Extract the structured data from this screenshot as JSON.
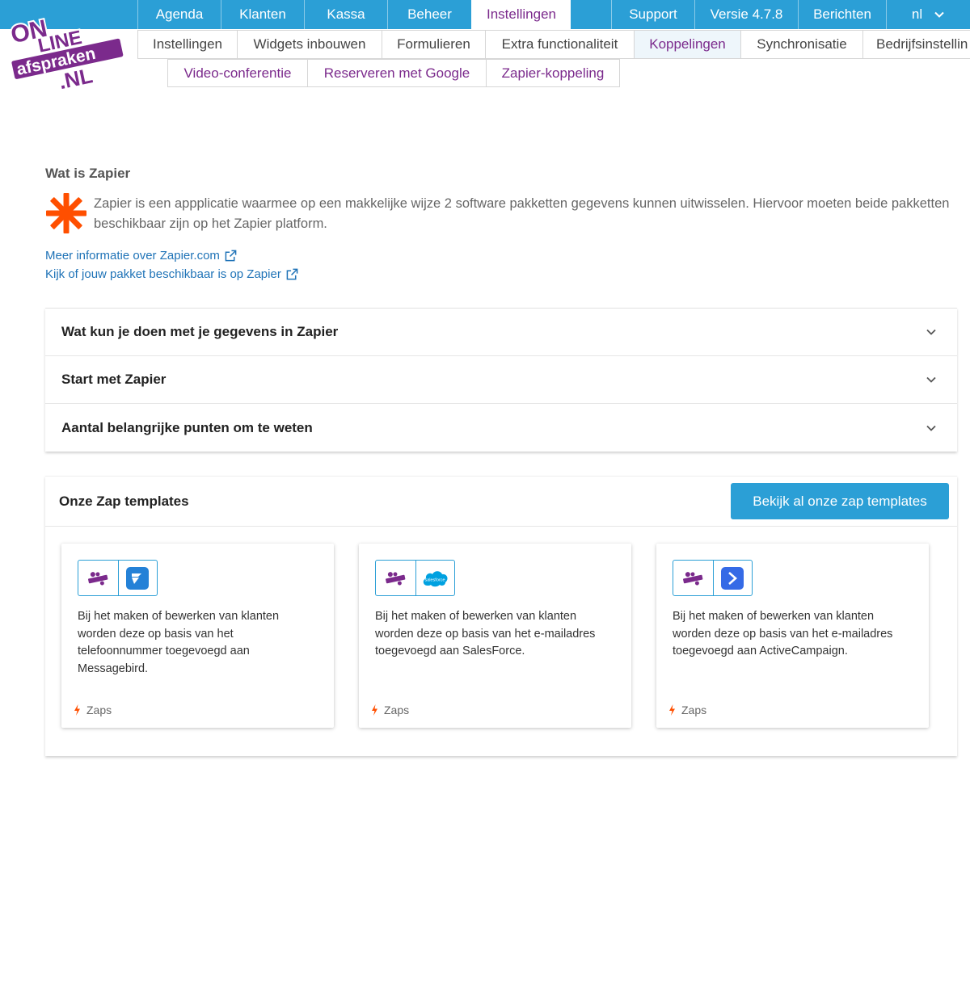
{
  "logo": {
    "name": "online-afspraken-logo",
    "text": "ONLINE afspraken .NL"
  },
  "topnav": {
    "left": [
      {
        "label": "Agenda"
      },
      {
        "label": "Klanten"
      },
      {
        "label": "Kassa"
      },
      {
        "label": "Beheer"
      },
      {
        "label": "Instellingen",
        "active": true
      }
    ],
    "right": [
      {
        "label": "Support"
      },
      {
        "label": "Versie 4.7.8"
      },
      {
        "label": "Berichten"
      },
      {
        "label": "nl",
        "dropdown": true
      }
    ]
  },
  "subnav": [
    {
      "label": "Instellingen"
    },
    {
      "label": "Widgets inbouwen"
    },
    {
      "label": "Formulieren"
    },
    {
      "label": "Extra functionaliteit"
    },
    {
      "label": "Koppelingen",
      "active": true
    },
    {
      "label": "Synchronisatie"
    },
    {
      "label": "Bedrijfsinstellin"
    }
  ],
  "thirdnav": [
    {
      "label": "Video-conferentie"
    },
    {
      "label": "Reserveren met Google"
    },
    {
      "label": "Zapier-koppeling",
      "active": true
    }
  ],
  "intro": {
    "title": "Wat is Zapier",
    "text": "Zapier is een appplicatie waarmee op een makkelijke wijze 2 software pakketten gegevens kunnen uitwisselen. Hiervoor moeten beide pakketten beschikbaar zijn op het Zapier platform.",
    "links": [
      {
        "label": "Meer informatie over Zapier.com"
      },
      {
        "label": "Kijk of jouw pakket beschikbaar is op Zapier"
      }
    ]
  },
  "accordion": [
    {
      "title": "Wat kun je doen met je gegevens in Zapier"
    },
    {
      "title": "Start met Zapier"
    },
    {
      "title": "Aantal belangrijke punten om te weten"
    }
  ],
  "templates": {
    "title": "Onze Zap templates",
    "button_label": "Bekijk al onze zap templates",
    "cards": [
      {
        "text": "Bij het maken of bewerken van klanten worden deze op basis van het telefoonnummer toegevoegd aan Messagebird.",
        "footer": "Zaps",
        "app_icon": "messagebird-icon"
      },
      {
        "text": "Bij het maken of bewerken van klanten worden deze op basis van het e-mailadres toegevoegd aan SalesForce.",
        "footer": "Zaps",
        "app_icon": "salesforce-icon",
        "app_icon_text": "salesforce"
      },
      {
        "text": "Bij het maken of bewerken van klanten worden deze op basis van het e-mailadres toegevoegd aan ActiveCampaign.",
        "footer": "Zaps",
        "app_icon": "activecampaign-icon"
      }
    ]
  },
  "colors": {
    "primary": "#2b9fd6",
    "active_text": "#7b2a8c",
    "link": "#1f73b7",
    "zapier_orange": "#ff4f00"
  }
}
